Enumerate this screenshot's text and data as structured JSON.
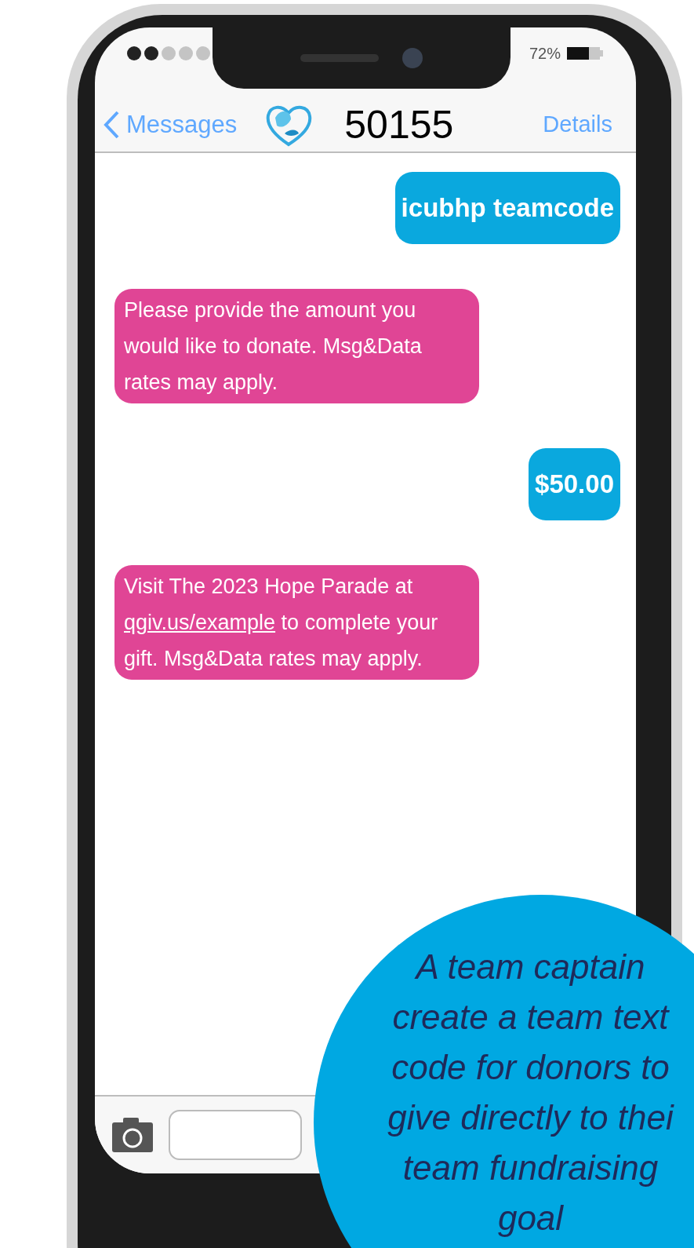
{
  "status_bar": {
    "battery": "72%"
  },
  "nav": {
    "back": "Messages",
    "title": "50155",
    "action": "Details"
  },
  "messages": [
    {
      "kind": "sent",
      "parts": [
        {
          "text": "icubhp teamcode"
        }
      ]
    },
    {
      "kind": "received",
      "parts": [
        {
          "text": "Please provide the amount you would like to donate. Msg&Data rates may apply."
        }
      ]
    },
    {
      "kind": "sent",
      "parts": [
        {
          "text": "$50.00"
        }
      ]
    },
    {
      "kind": "received",
      "parts": [
        {
          "text": "Visit The 2023 Hope Parade at "
        },
        {
          "text": "qgiv.us/example",
          "kind": "link"
        },
        {
          "text": " to complete your gift. Msg&Data rates may apply."
        }
      ]
    }
  ],
  "caption": {
    "lines": [
      "A team captain",
      "create a team text",
      "code for donors to",
      "give directly to thei",
      "team fundraising",
      "goal"
    ]
  }
}
